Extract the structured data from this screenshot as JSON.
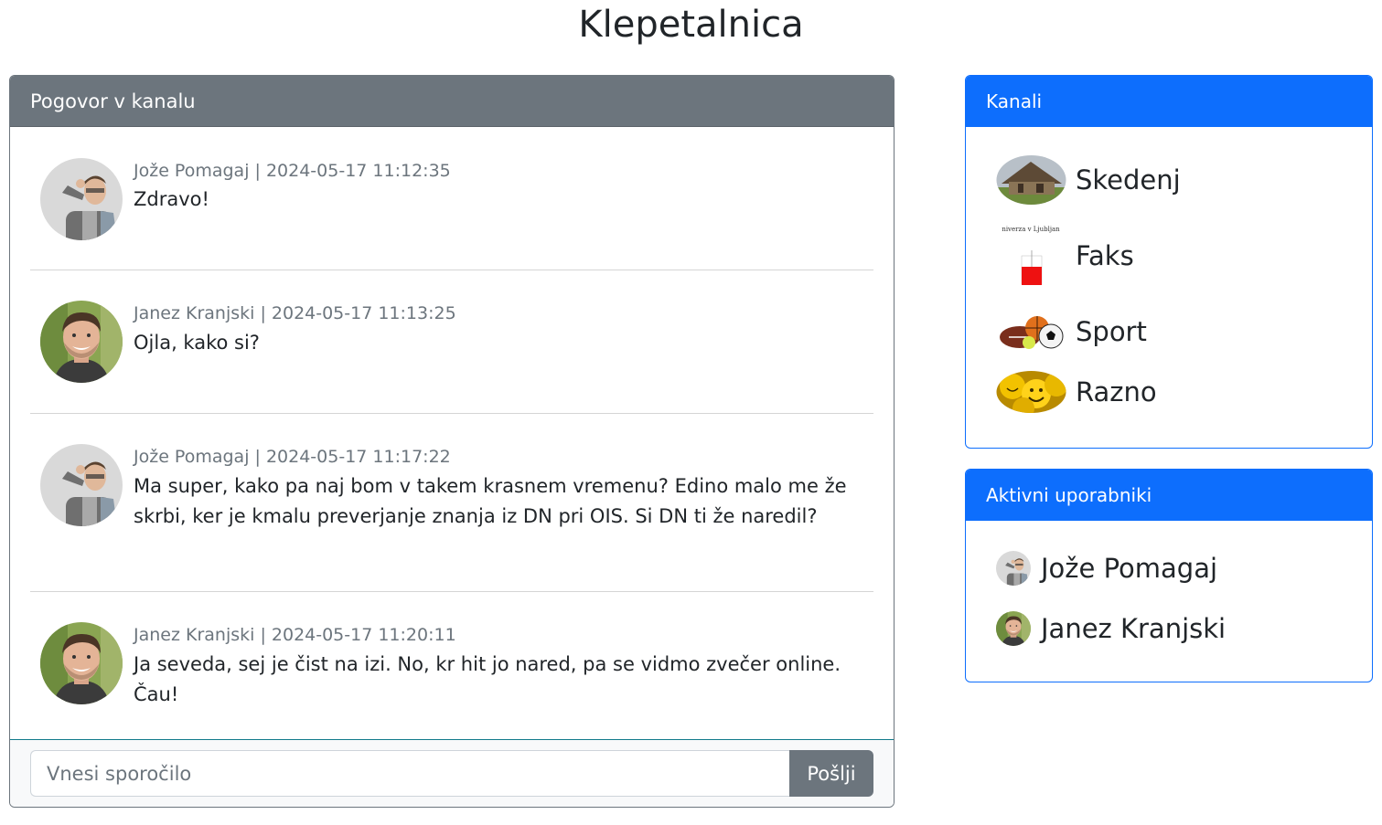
{
  "app": {
    "title": "Klepetalnica"
  },
  "chat": {
    "header": "Pogovor v kanalu",
    "messages": [
      {
        "meta": "Jože Pomagaj | 2024-05-17 11:12:35",
        "text": "Zdravo!",
        "avatar": "joze-avatar"
      },
      {
        "meta": "Janez Kranjski | 2024-05-17 11:13:25",
        "text": "Ojla, kako si?",
        "avatar": "janez-avatar"
      },
      {
        "meta": "Jože Pomagaj | 2024-05-17 11:17:22",
        "text": "Ma super, kako pa naj bom v takem krasnem vremenu? Edino malo me že skrbi, ker je kmalu preverjanje znanja iz DN pri OIS. Si DN ti že naredil?",
        "avatar": "joze-avatar"
      },
      {
        "meta": "Janez Kranjski | 2024-05-17 11:20:11",
        "text": "Ja seveda, sej je čist na izi. No, kr hit jo nared, pa se vidmo zvečer online. Čau!",
        "avatar": "janez-avatar"
      }
    ],
    "input": {
      "placeholder": "Vnesi sporočilo",
      "value": ""
    },
    "send_label": "Pošlji"
  },
  "channels": {
    "header": "Kanali",
    "items": [
      {
        "label": "Skedenj",
        "icon": "barn-image"
      },
      {
        "label": "Faks",
        "icon": "faculty-image",
        "caption": "niverza v Ljubljan"
      },
      {
        "label": "Sport",
        "icon": "sport-balls-image"
      },
      {
        "label": "Razno",
        "icon": "smileys-image"
      }
    ]
  },
  "users": {
    "header": "Aktivni uporabniki",
    "items": [
      {
        "label": "Jože Pomagaj",
        "avatar": "joze-avatar"
      },
      {
        "label": "Janez Kranjski",
        "avatar": "janez-avatar"
      }
    ]
  },
  "colors": {
    "primary": "#0d6efd",
    "secondary": "#6c757d",
    "divider": "#d5d5d5"
  }
}
